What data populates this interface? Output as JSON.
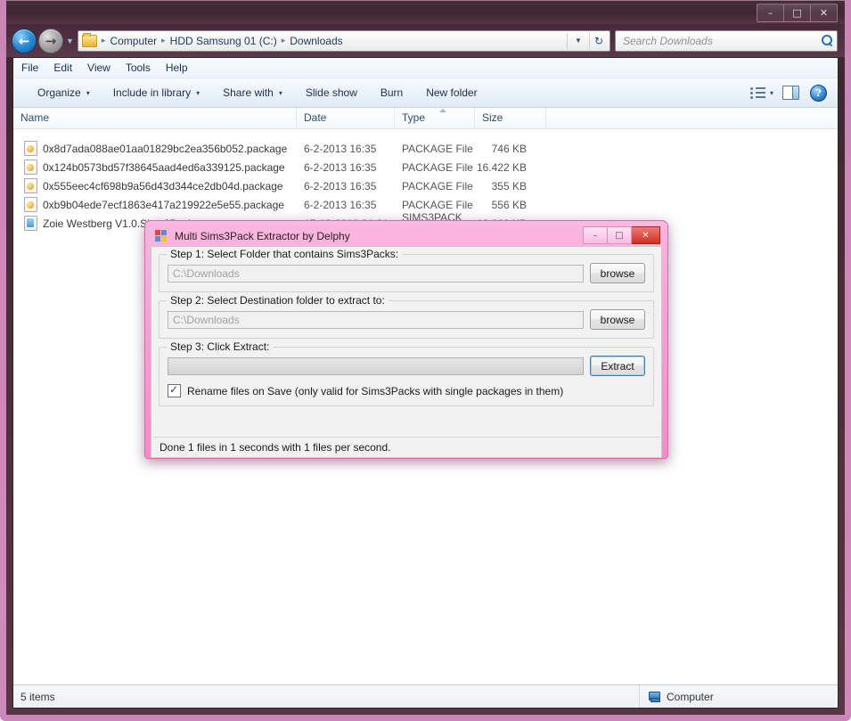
{
  "window": {
    "controls": {
      "minimize": "–",
      "maximize": "□",
      "close": "✕"
    }
  },
  "nav": {
    "back_icon": "←",
    "forward_icon": "→",
    "history_caret": "▼",
    "breadcrumbs": [
      "Computer",
      "HDD Samsung 01 (C:)",
      "Downloads"
    ],
    "separator": "▸",
    "address_dropdown": "▼",
    "refresh_icon": "↻"
  },
  "search": {
    "placeholder": "Search Downloads"
  },
  "menubar": {
    "items": [
      "File",
      "Edit",
      "View",
      "Tools",
      "Help"
    ]
  },
  "toolbar": {
    "items": [
      {
        "label": "Organize",
        "caret": "▾"
      },
      {
        "label": "Include in library",
        "caret": "▾"
      },
      {
        "label": "Share with",
        "caret": "▾"
      },
      {
        "label": "Slide show",
        "caret": ""
      },
      {
        "label": "Burn",
        "caret": ""
      },
      {
        "label": "New folder",
        "caret": ""
      }
    ],
    "view_caret": "▾",
    "help_label": "?"
  },
  "filelist": {
    "columns": [
      "Name",
      "Date",
      "Type",
      "Size"
    ],
    "sorted_column": "Type",
    "rows": [
      {
        "name": "0x8d7ada088ae01aa01829bc2ea356b052.package",
        "date": "6-2-2013 16:35",
        "type": "PACKAGE File",
        "size": "746 KB",
        "icon": "package-file-icon"
      },
      {
        "name": "0x124b0573bd57f38645aad4ed6a339125.package",
        "date": "6-2-2013 16:35",
        "type": "PACKAGE File",
        "size": "16.422 KB",
        "icon": "package-file-icon"
      },
      {
        "name": "0x555eec4cf698b9a56d43d344ce2db04d.package",
        "date": "6-2-2013 16:35",
        "type": "PACKAGE File",
        "size": "355 KB",
        "icon": "package-file-icon"
      },
      {
        "name": "0xb9b04ede7ecf1863e417a219922e5e55.package",
        "date": "6-2-2013 16:35",
        "type": "PACKAGE File",
        "size": "556 KB",
        "icon": "package-file-icon"
      },
      {
        "name": "Zoie Westberg V1.0.Sims3Pack",
        "date": "17-12-2012 21:21",
        "type": "SIMS3PACK File",
        "size": "19.262 KB",
        "icon": "sims3pack-file-icon"
      }
    ]
  },
  "statusbar": {
    "item_count": "5 items",
    "location": "Computer"
  },
  "dialog": {
    "title": "Multi Sims3Pack Extractor by Delphy",
    "controls": {
      "minimize": "–",
      "maximize": "□",
      "close": "✕"
    },
    "step1": {
      "label": "Step 1: Select Folder that contains Sims3Packs:",
      "value": "C:\\Downloads",
      "browse_label": "browse"
    },
    "step2": {
      "label": "Step 2: Select Destination folder to extract to:",
      "value": "C:\\Downloads",
      "browse_label": "browse"
    },
    "step3": {
      "label": "Step 3: Click Extract:",
      "extract_label": "Extract",
      "progress_percent": 0
    },
    "rename_checkbox": {
      "label": "Rename files on Save (only valid for Sims3Packs with single packages in them)",
      "checked": true
    },
    "status": "Done 1 files in 1 seconds with 1 files per second."
  },
  "colors": {
    "dialog_pink": "#f79fd4",
    "frame_pink": "#eea0d8",
    "titlebar_dark": "#3a232e",
    "accent_blue": "#2f6fb5",
    "close_red": "#cf2f22"
  }
}
